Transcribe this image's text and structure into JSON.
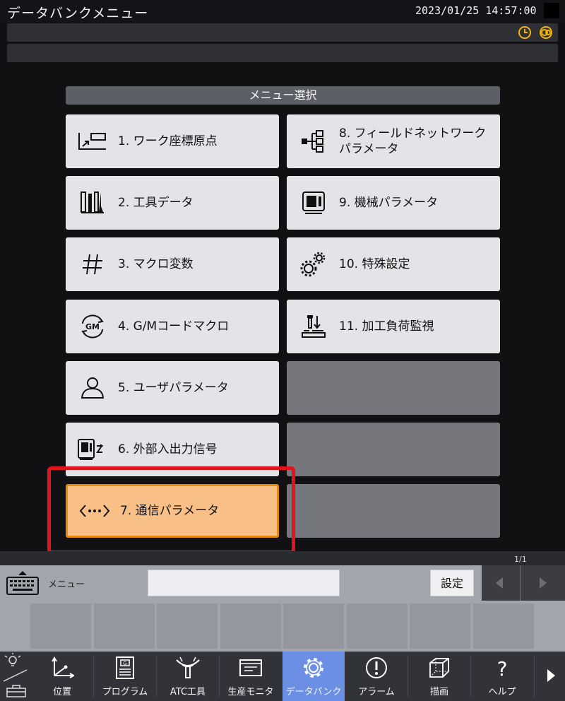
{
  "header": {
    "title": "データバンクメニュー",
    "datetime": "2023/01/25 14:57:00"
  },
  "menu": {
    "heading": "メニュー選択",
    "left": [
      {
        "label": "1. ワーク座標原点",
        "icon": "work-coordinate-icon"
      },
      {
        "label": "2. 工具データ",
        "icon": "tools-icon"
      },
      {
        "label": "3. マクロ変数",
        "icon": "hash-icon"
      },
      {
        "label": "4. G/Mコードマクロ",
        "icon": "gm-code-icon"
      },
      {
        "label": "5. ユーザパラメータ",
        "icon": "user-icon"
      },
      {
        "label": "6. 外部入出力信号",
        "icon": "io-signal-icon"
      },
      {
        "label": "7. 通信パラメータ",
        "icon": "communication-icon",
        "selected": true
      }
    ],
    "right": [
      {
        "label": "8. フィールドネットワークパラメータ",
        "icon": "network-tree-icon"
      },
      {
        "label": "9. 機械パラメータ",
        "icon": "machine-icon"
      },
      {
        "label": "10. 特殊設定",
        "icon": "gears-icon"
      },
      {
        "label": "11. 加工負荷監視",
        "icon": "load-monitor-icon"
      },
      {
        "label": ""
      },
      {
        "label": ""
      },
      {
        "label": ""
      }
    ]
  },
  "input": {
    "menu_tag": "メニュー",
    "value": "",
    "set_label": "設定",
    "page": "1/1"
  },
  "nav": [
    {
      "label": "位置",
      "icon": "axes-icon"
    },
    {
      "label": "プログラム",
      "icon": "program-icon"
    },
    {
      "label": "ATC工具",
      "icon": "atc-tool-icon"
    },
    {
      "label": "生産モニタ",
      "icon": "monitor-icon"
    },
    {
      "label": "データバンク",
      "icon": "gear-icon",
      "active": true
    },
    {
      "label": "アラーム",
      "icon": "alarm-icon"
    },
    {
      "label": "描画",
      "icon": "cube-icon"
    },
    {
      "label": "ヘルプ",
      "icon": "help-icon"
    }
  ],
  "colors": {
    "accent": "#6c8fe6",
    "selected_fill": "#f8bf86",
    "selected_border": "#e8890e",
    "highlight_frame": "#e0141b",
    "status_icon": "#f2b705"
  }
}
